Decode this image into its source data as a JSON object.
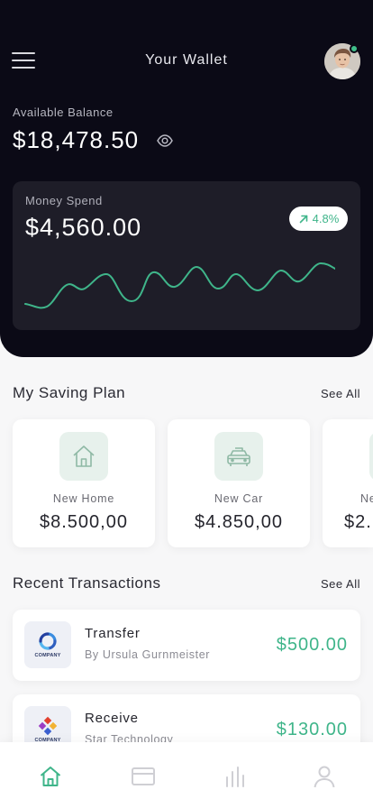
{
  "header": {
    "title": "Your Wallet"
  },
  "balance": {
    "label": "Available Balance",
    "value": "$18,478.50"
  },
  "spend": {
    "label": "Money Spend",
    "value": "$4,560.00",
    "trend": "4.8%"
  },
  "saving_plan": {
    "title": "My Saving Plan",
    "see_all": "See All",
    "items": [
      {
        "name": "New Home",
        "amount": "$8.500,00",
        "icon": "home-icon"
      },
      {
        "name": "New Car",
        "amount": "$4.850,00",
        "icon": "car-icon"
      },
      {
        "name": "Ne",
        "amount": "$2.",
        "icon": "plan-icon"
      }
    ]
  },
  "transactions": {
    "title": "Recent Transactions",
    "see_all": "See All",
    "items": [
      {
        "title": "Transfer",
        "subtitle": "By Ursula Gurnmeister",
        "amount": "$500.00",
        "logo_text": "COMPANY"
      },
      {
        "title": "Receive",
        "subtitle": "Star Technology",
        "amount": "$130.00",
        "logo_text": "COMPANY"
      }
    ]
  },
  "nav": {
    "items": [
      "home-icon",
      "card-icon",
      "chart-icon",
      "profile-icon"
    ],
    "active": "home-icon"
  },
  "colors": {
    "dark_bg": "#0b0a16",
    "card_bg": "#1e1d28",
    "accent": "#3fb58a"
  }
}
